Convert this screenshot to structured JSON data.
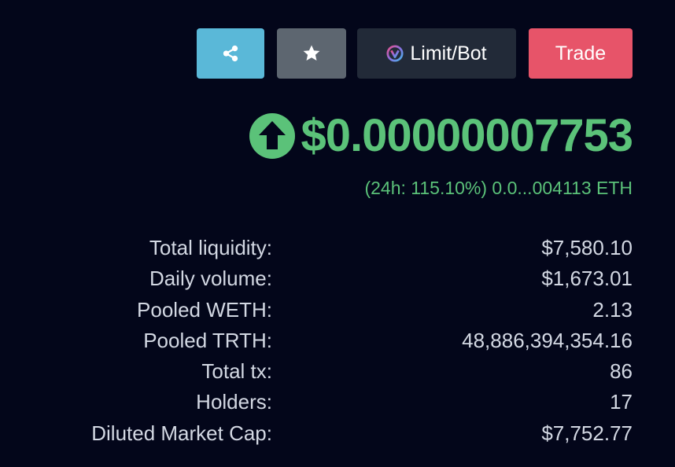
{
  "toolbar": {
    "share_icon": "share-icon",
    "favorite_icon": "star-icon",
    "limit_label": "Limit/Bot",
    "limit_icon": "unibot-logo-icon",
    "trade_label": "Trade"
  },
  "price": {
    "direction_icon": "arrow-up-circle-icon",
    "value": "$0.00000007753",
    "change_24h": "(24h: 115.10%) 0.0...004113 ETH"
  },
  "stats": [
    {
      "label": "Total liquidity:",
      "value": "$7,580.10"
    },
    {
      "label": "Daily volume:",
      "value": "$1,673.01"
    },
    {
      "label": "Pooled WETH:",
      "value": "2.13"
    },
    {
      "label": "Pooled TRTH:",
      "value": "48,886,394,354.16"
    },
    {
      "label": "Total tx:",
      "value": "86"
    },
    {
      "label": "Holders:",
      "value": "17"
    },
    {
      "label": "Diluted Market Cap:",
      "value": "$7,752.77"
    }
  ],
  "colors": {
    "background": "#03061a",
    "positive": "#5bc279",
    "share_button": "#5ab8d8",
    "favorite_button": "#5d6670",
    "limit_button": "#222a38",
    "trade_button": "#e75469",
    "text": "#d3d8e3"
  }
}
